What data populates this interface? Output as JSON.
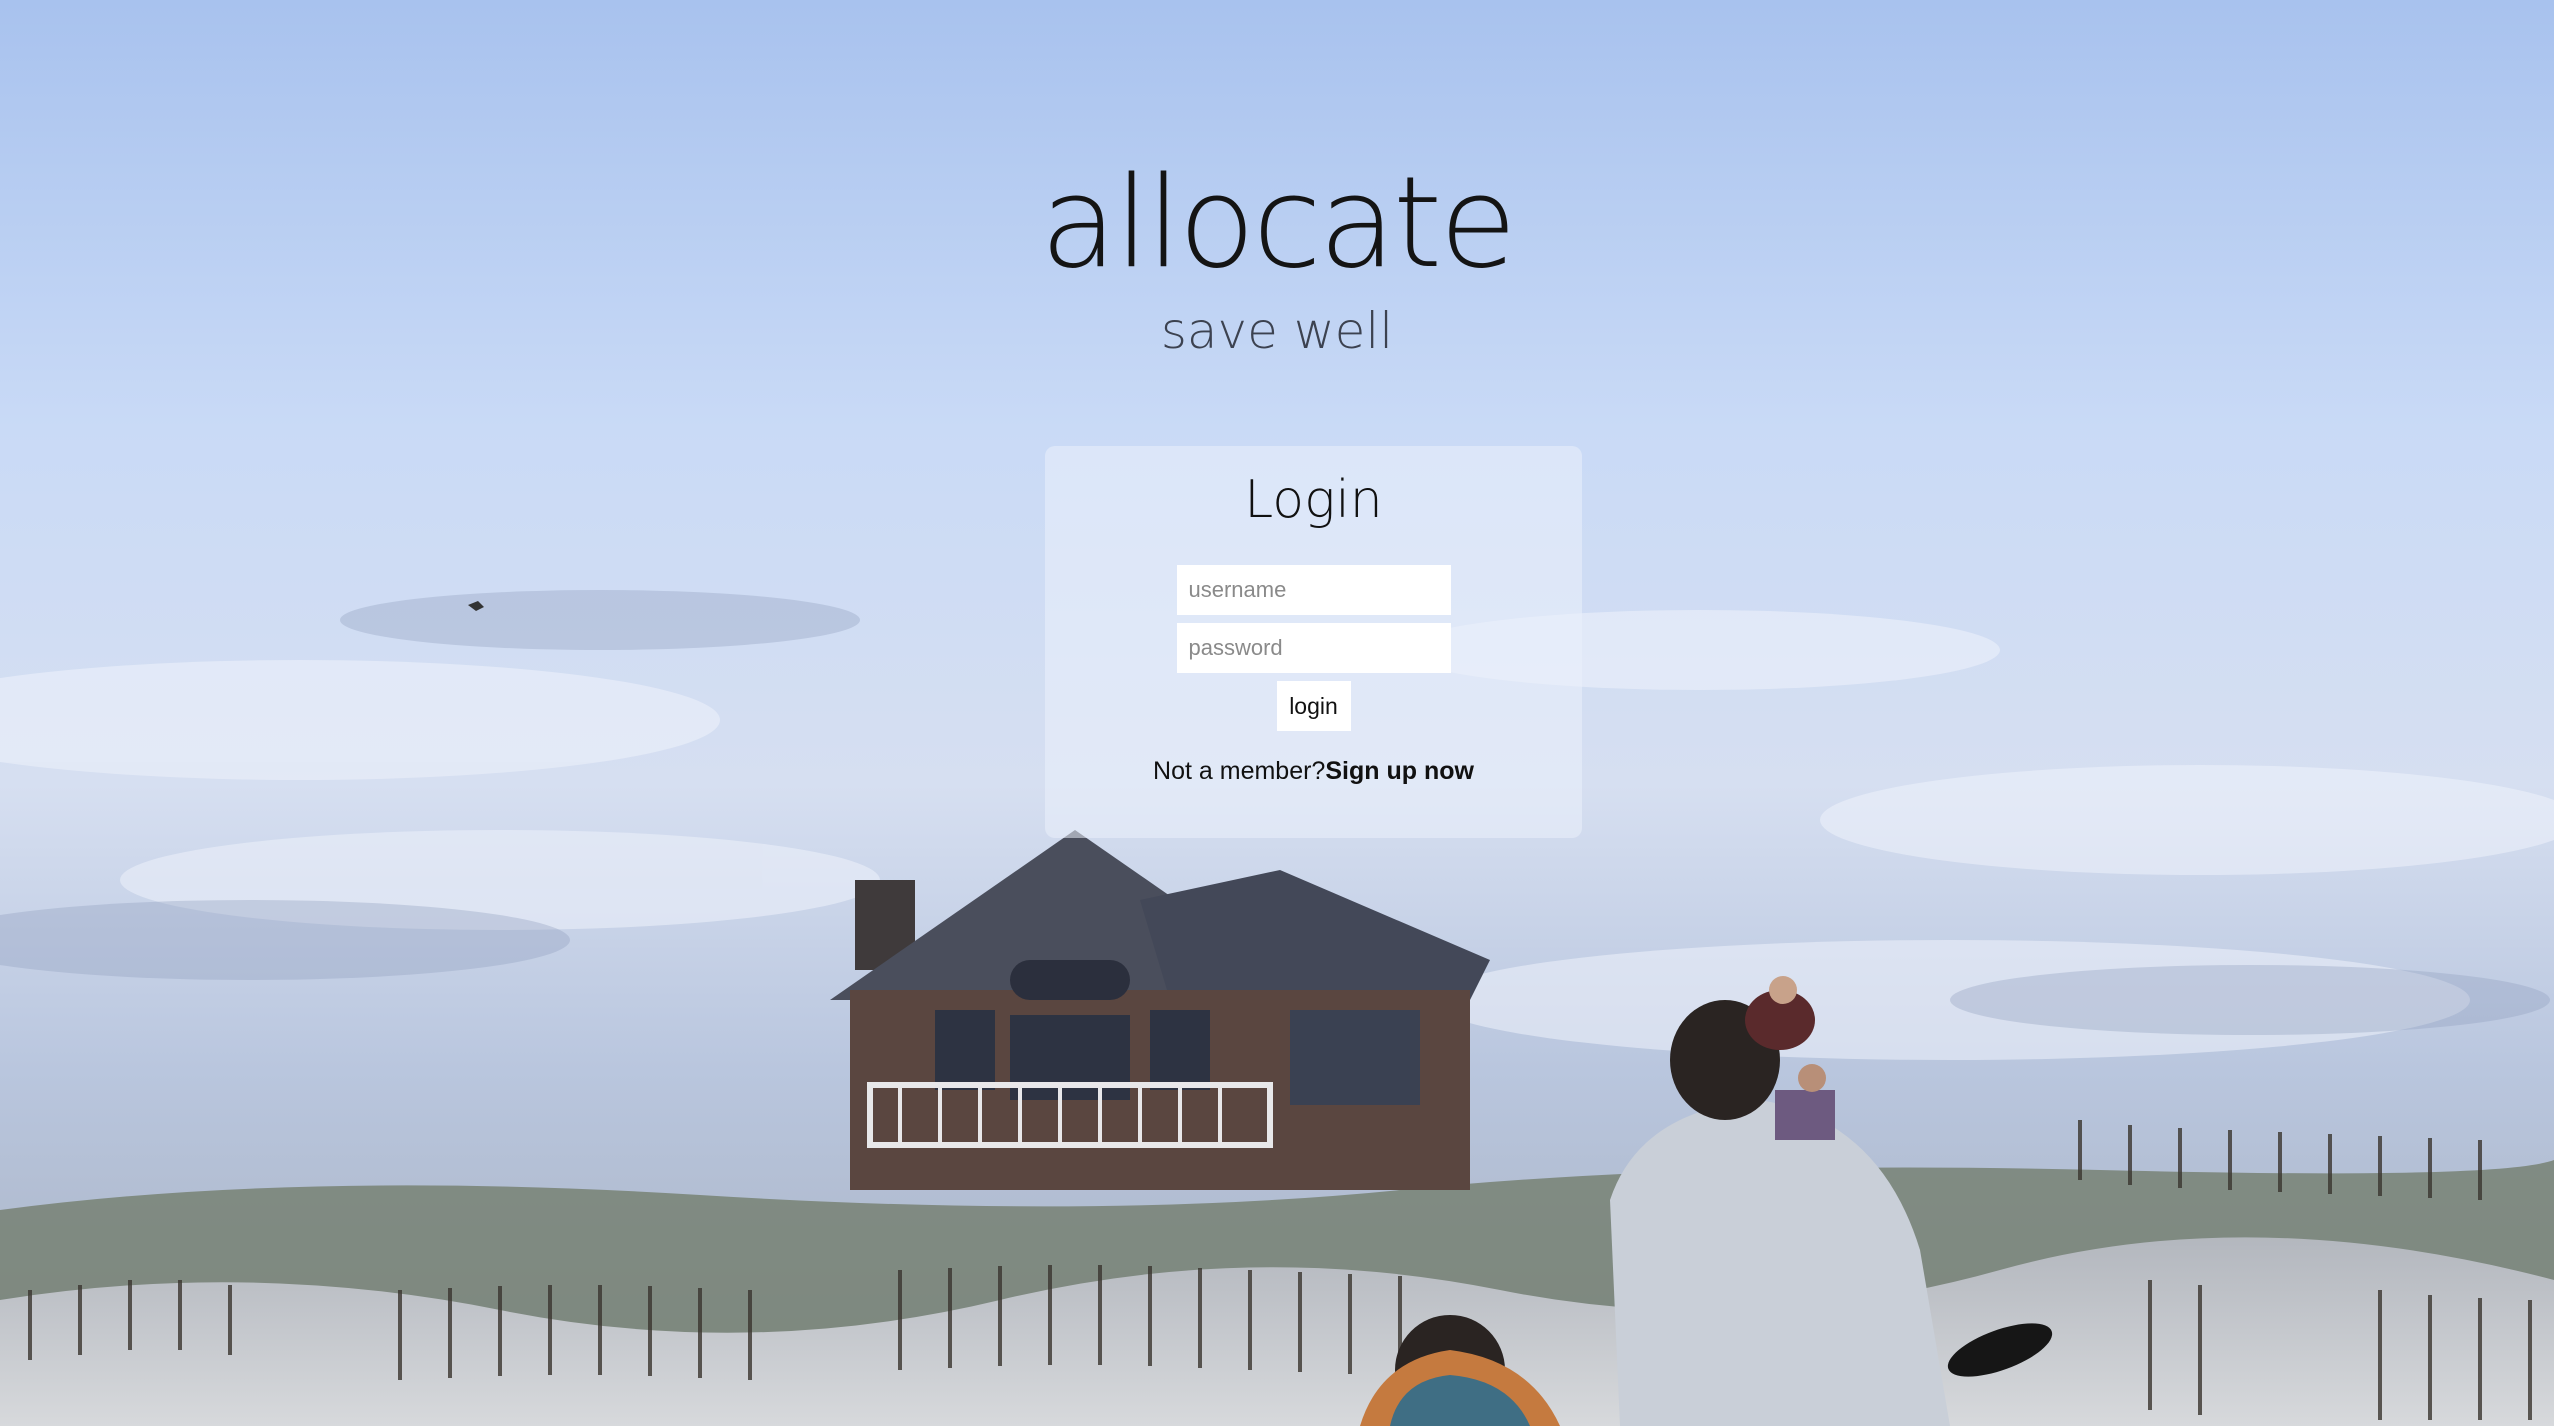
{
  "brand": {
    "title": "allocate",
    "tagline": "save well"
  },
  "login_form": {
    "heading": "Login",
    "username_placeholder": "username",
    "password_placeholder": "password",
    "submit_label": "login",
    "signup_prompt": "Not a member?",
    "signup_link": "Sign up now"
  },
  "colors": {
    "card_background": "#ebf1fc",
    "text": "#111111",
    "tagline": "#3c4250"
  }
}
